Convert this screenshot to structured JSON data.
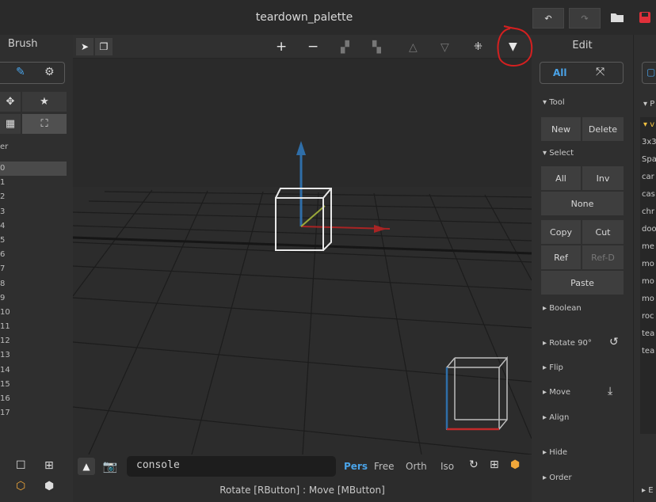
{
  "window": {
    "title": "teardown_palette"
  },
  "titlebar": {
    "undo_icon": "undo-icon",
    "redo_icon": "redo-icon",
    "open_icon": "folder-icon",
    "save_icon": "save-icon"
  },
  "brush_panel": {
    "title": "Brush",
    "layer_label": "er",
    "layers": [
      "0",
      "1",
      "2",
      "3",
      "4",
      "5",
      "6",
      "7",
      "8",
      "9",
      "10",
      "11",
      "12",
      "13",
      "14",
      "15",
      "16",
      "17"
    ]
  },
  "viewport": {
    "console_placeholder": "console",
    "projections": [
      "Pers",
      "Free",
      "Orth",
      "Iso"
    ],
    "active_projection": "Pers",
    "status": "Rotate [RButton] : Move [MButton]"
  },
  "edit_panel": {
    "title": "Edit",
    "filter_all": "All",
    "sections": {
      "tool": "▾ Tool",
      "select": "▾ Select",
      "boolean": "▸ Boolean",
      "rotate": "▸ Rotate 90°",
      "flip": "▸ Flip",
      "move": "▸ Move",
      "align": "▸ Align",
      "hide": "▸ Hide",
      "order": "▸ Order"
    },
    "buttons": {
      "new": "New",
      "delete": "Delete",
      "all": "All",
      "inv": "Inv",
      "none": "None",
      "copy": "Copy",
      "cut": "Cut",
      "ref": "Ref",
      "ref_d": "Ref-D",
      "paste": "Paste"
    }
  },
  "palette_panel": {
    "header": "▾ P",
    "group": "▾ v",
    "items": [
      "3x3",
      "Spa",
      "car",
      "cas",
      "chr",
      "doo",
      "me",
      "mo",
      "mo",
      "mo",
      "roc",
      "tea",
      "tea"
    ],
    "footer": "▸ E"
  }
}
